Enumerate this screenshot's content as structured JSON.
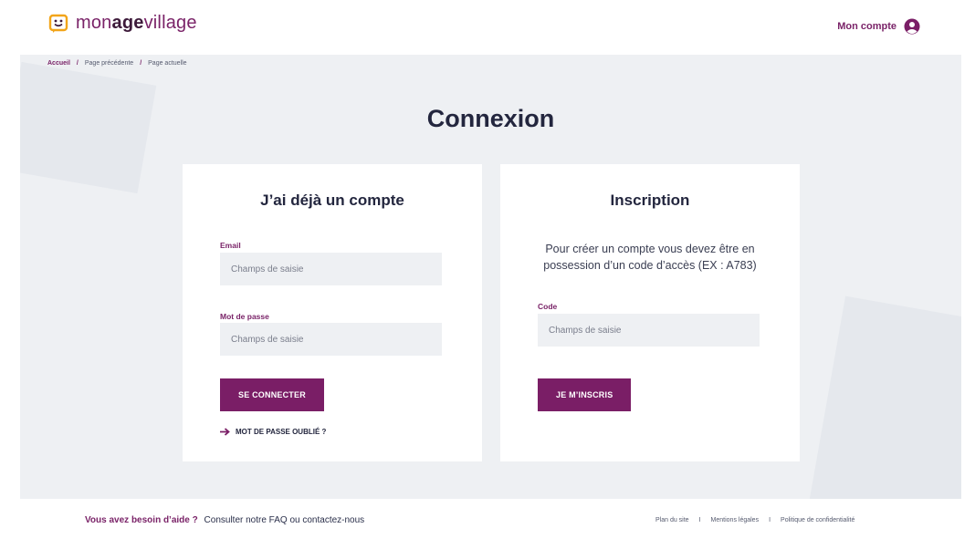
{
  "header": {
    "logo": {
      "part1": "mon",
      "part2": "age",
      "part3": "village"
    },
    "account_label": "Mon compte"
  },
  "breadcrumb": {
    "home": "Accueil",
    "separator": "/",
    "previous": "Page précédente",
    "current": "Page actuelle"
  },
  "page_title": "Connexion",
  "login": {
    "heading": "J’ai déjà un compte",
    "email_label": "Email",
    "email_placeholder": "Champs de saisie",
    "password_label": "Mot de passe",
    "password_placeholder": "Champs de saisie",
    "submit_label": "SE CONNECTER",
    "forgot_label": "MOT DE PASSE OUBLIÉ ?"
  },
  "signup": {
    "heading": "Inscription",
    "info": "Pour créer un compte vous devez être en possession d’un code d’accès (EX : A783)",
    "code_label": "Code",
    "code_placeholder": "Champs de saisie",
    "submit_label": "JE M’INSCRIS"
  },
  "footer": {
    "help_question": "Vous avez besoin d’aide ?",
    "help_link": "Consulter notre FAQ ou contactez-nous",
    "links": [
      "Plan du site",
      "Mentions légales",
      "Politique de confidentialité"
    ],
    "link_separator": "I"
  },
  "colors": {
    "accent": "#7a1e66",
    "brand_text": "#7a2368",
    "title": "#23263e",
    "background": "#eef0f3"
  },
  "icons": {
    "logo": "smiley-chat-bubble-icon",
    "account": "user-circle-icon",
    "forgot": "arrow-right-icon"
  }
}
